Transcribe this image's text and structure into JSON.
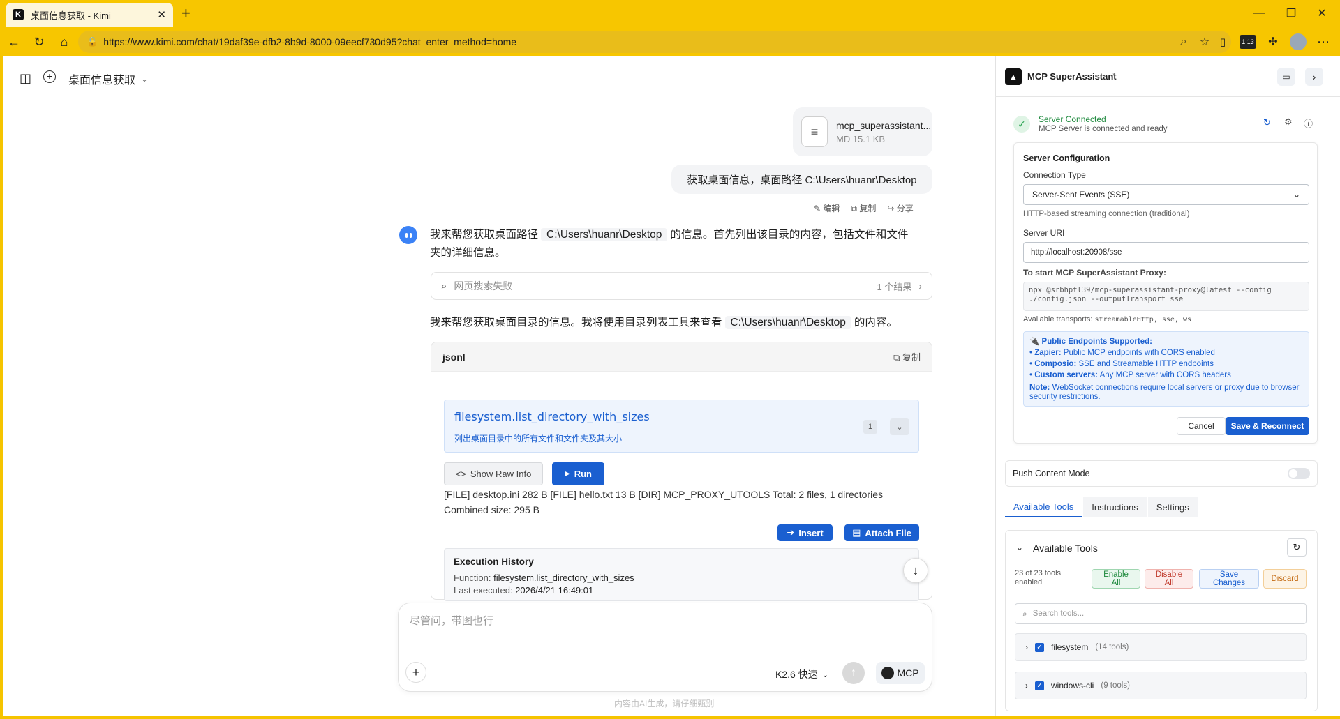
{
  "browser": {
    "tab_title": "桌面信息获取 - Kimi",
    "favicon": "K",
    "new_tab": "+",
    "url": "https://www.kimi.com/chat/19daf39e-dfb2-8b9d-8000-09eecf730d95?chat_enter_method=home",
    "ext_badge": "1.13"
  },
  "chat": {
    "title": "桌面信息获取",
    "file": {
      "name": "mcp_superassistant...",
      "meta": "MD 15.1 KB"
    },
    "user_message": "获取桌面信息，桌面路径 C:\\Users\\huanr\\Desktop",
    "actions": {
      "edit": "编辑",
      "copy": "复制",
      "share": "分享"
    },
    "assistant_intro_a": "我来帮您获取桌面路径",
    "assistant_intro_path": "C:\\Users\\huanr\\Desktop",
    "assistant_intro_b": "的信息。首先列出该目录的内容，包括文件和文件",
    "assistant_intro_c": "夹的详细信息。",
    "search_failed": "网页搜索失败",
    "search_results": "1 个结果",
    "second_a": "我来帮您获取桌面目录的信息。我将使用目录列表工具来查看",
    "second_path": "C:\\Users\\huanr\\Desktop",
    "second_b": "的内容。",
    "code_lang": "jsonl",
    "code_copy": "复制",
    "tool_name": "filesystem.list_directory_with_sizes",
    "tool_desc": "列出桌面目录中的所有文件和文件夹及其大小",
    "tool_count": "1",
    "show_raw": "Show Raw Info",
    "run": "Run",
    "result_line1": "[FILE] desktop.ini 282 B [FILE] hello.txt 13 B [DIR] MCP_PROXY_UTOOLS Total: 2 files, 1 directories",
    "result_line2": "Combined size: 295 B",
    "insert": "Insert",
    "attach": "Attach File",
    "history_title": "Execution History",
    "history_function_label": "Function:",
    "history_function": "filesystem.list_directory_with_sizes",
    "history_last_label": "Last executed:",
    "history_last": "2026/4/21 16:49:01",
    "input_placeholder": "尽管问，带图也行",
    "model": "K2.6 快速",
    "mcp_label": "MCP",
    "disclaimer": "内容由AI生成，请仔细甄别"
  },
  "panel": {
    "title": "MCP SuperAssistant",
    "status_title": "Server Connected",
    "status_sub": "MCP Server is connected and ready",
    "config_title": "Server Configuration",
    "conn_type_label": "Connection Type",
    "conn_type_value": "Server-Sent Events (SSE)",
    "conn_type_hint": "HTTP-based streaming connection (traditional)",
    "uri_label": "Server URI",
    "uri_value": "http://localhost:20908/sse",
    "proxy_label": "To start MCP SuperAssistant Proxy:",
    "proxy_cmd": "npx @srbhptl39/mcp-superassistant-proxy@latest --config ./config.json --outputTransport sse",
    "transports_label": "Available transports:",
    "transports_value": "streamableHttp, sse, ws",
    "endpoints_title": "Public Endpoints Supported:",
    "ep1_b": "Zapier:",
    "ep1": "Public MCP endpoints with CORS enabled",
    "ep2_b": "Composio:",
    "ep2": "SSE and Streamable HTTP endpoints",
    "ep3_b": "Custom servers:",
    "ep3": "Any MCP server with CORS headers",
    "note_b": "Note:",
    "note": "WebSocket connections require local servers or proxy due to browser security restrictions.",
    "cancel": "Cancel",
    "save_reconnect": "Save & Reconnect",
    "push_mode": "Push Content Mode",
    "tabs": [
      "Available Tools",
      "Instructions",
      "Settings"
    ],
    "tools_title": "Available Tools",
    "tools_enabled": "23 of 23 tools enabled",
    "enable_all": "Enable All",
    "disable_all": "Disable All",
    "save_changes": "Save Changes",
    "discard": "Discard",
    "search_placeholder": "Search tools...",
    "groups": [
      {
        "name": "filesystem",
        "count": "(14 tools)"
      },
      {
        "name": "windows-cli",
        "count": "(9 tools)"
      }
    ]
  }
}
